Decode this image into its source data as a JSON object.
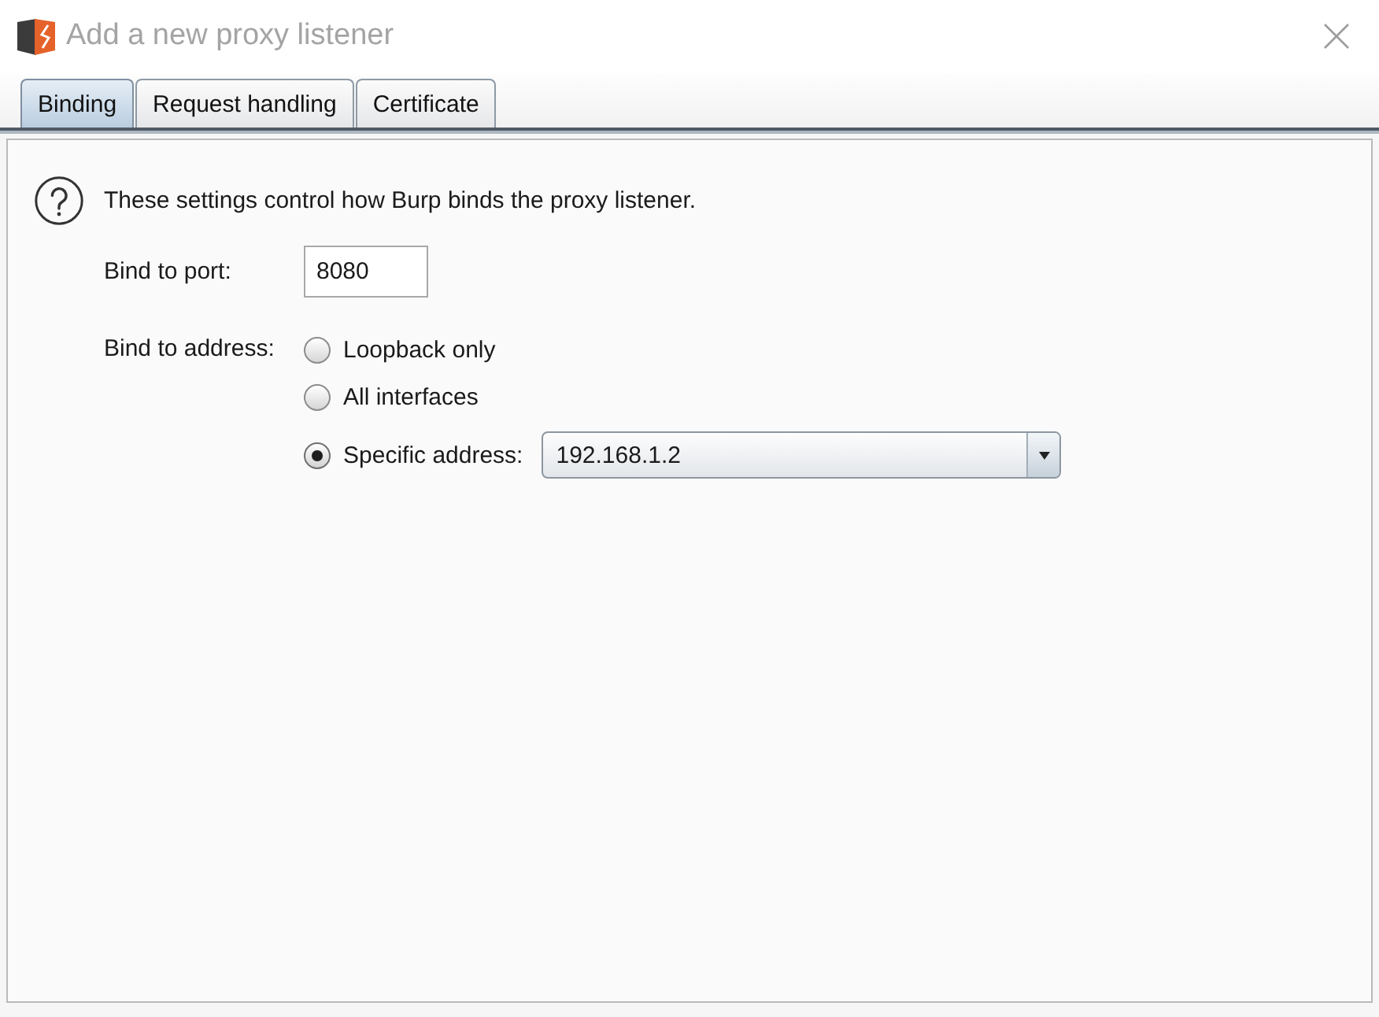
{
  "window": {
    "title": "Add a new proxy listener"
  },
  "tabs": [
    {
      "label": "Binding",
      "selected": true
    },
    {
      "label": "Request handling",
      "selected": false
    },
    {
      "label": "Certificate",
      "selected": false
    }
  ],
  "binding": {
    "description": "These settings control how Burp binds the proxy listener.",
    "port": {
      "label": "Bind to port:",
      "value": "8080"
    },
    "address": {
      "label": "Bind to address:",
      "options": [
        {
          "kind": "plain",
          "label": "Loopback only",
          "selected": false
        },
        {
          "kind": "plain",
          "label": "All interfaces",
          "selected": false
        },
        {
          "kind": "address",
          "label": "Specific address:",
          "selected": true,
          "value": "192.168.1.2"
        }
      ]
    }
  }
}
